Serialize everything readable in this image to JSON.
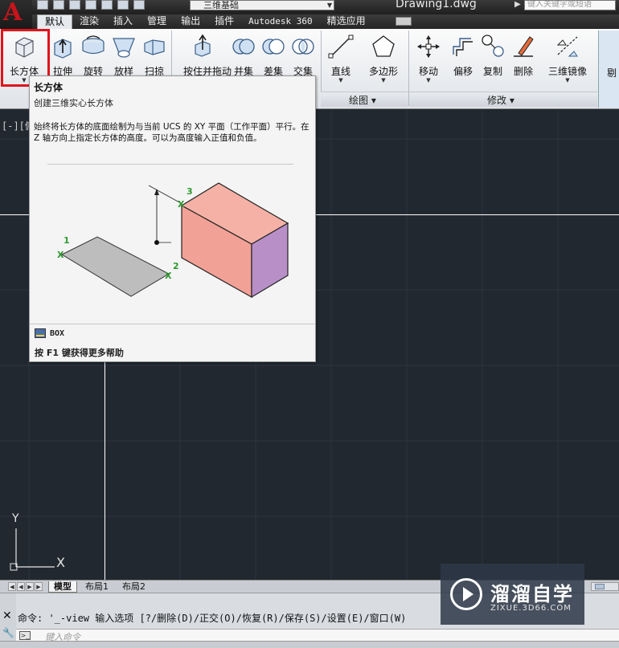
{
  "titlebar": {
    "workspace": "三维基础",
    "document_title": "Drawing1.dwg",
    "search_placeholder": "键入关键字或短语"
  },
  "ribbon_tabs": [
    "默认",
    "渲染",
    "插入",
    "管理",
    "输出",
    "插件",
    "Autodesk 360",
    "精选应用"
  ],
  "ribbon": {
    "create_buttons": [
      {
        "label": "长方体",
        "icon": "box-icon"
      },
      {
        "label": "拉伸",
        "icon": "extrude-icon"
      },
      {
        "label": "旋转",
        "icon": "revolve-icon"
      },
      {
        "label": "放样",
        "icon": "loft-icon"
      },
      {
        "label": "扫掠",
        "icon": "sweep-icon"
      }
    ],
    "edit_buttons": [
      {
        "label": "按住并拖动",
        "icon": "presspull-icon"
      },
      {
        "label": "并集",
        "icon": "union-icon"
      },
      {
        "label": "差集",
        "icon": "subtract-icon"
      },
      {
        "label": "交集",
        "icon": "intersect-icon"
      }
    ],
    "draw_buttons": [
      {
        "label": "直线",
        "icon": "line-icon"
      },
      {
        "label": "多边形",
        "icon": "polygon-icon"
      }
    ],
    "draw_panel_title": "绘图",
    "modify_buttons": [
      {
        "label": "移动",
        "icon": "move-icon"
      },
      {
        "label": "偏移",
        "icon": "offset-icon"
      },
      {
        "label": "复制",
        "icon": "copy-icon"
      },
      {
        "label": "删除",
        "icon": "erase-icon"
      },
      {
        "label": "三维镜像",
        "icon": "mirror3d-icon"
      }
    ],
    "modify_panel_title": "修改",
    "right_edge_label": "剔"
  },
  "viewport_label": "[-][俯",
  "tooltip": {
    "title": "长方体",
    "description": "创建三维实心长方体",
    "body": "始终将长方体的底面绘制为与当前 UCS 的 XY 平面（工作平面）平行。在 Z 轴方向上指定长方体的高度。可以为高度输入正值和负值。",
    "figure_labels": [
      "1",
      "2",
      "3"
    ],
    "command": "BOX",
    "help": "按 F1 键获得更多帮助"
  },
  "ucs": {
    "x_label": "X",
    "y_label": "Y"
  },
  "layout_tabs": [
    "模型",
    "布局1",
    "布局2"
  ],
  "command_line": {
    "history": "命令: '_-view 输入选项 [?/删除(D)/正交(O)/恢复(R)/保存(S)/设置(E)/窗口(W)",
    "input_placeholder": "键入命令"
  },
  "watermark": {
    "name": "溜溜自学",
    "url": "ZIXUE.3D66.COM"
  },
  "colors": {
    "canvas": "#212830",
    "grid_line": "#2d3540",
    "highlight": "#e0141b",
    "box_front": "#f2a196",
    "box_side": "#b88fc7"
  }
}
